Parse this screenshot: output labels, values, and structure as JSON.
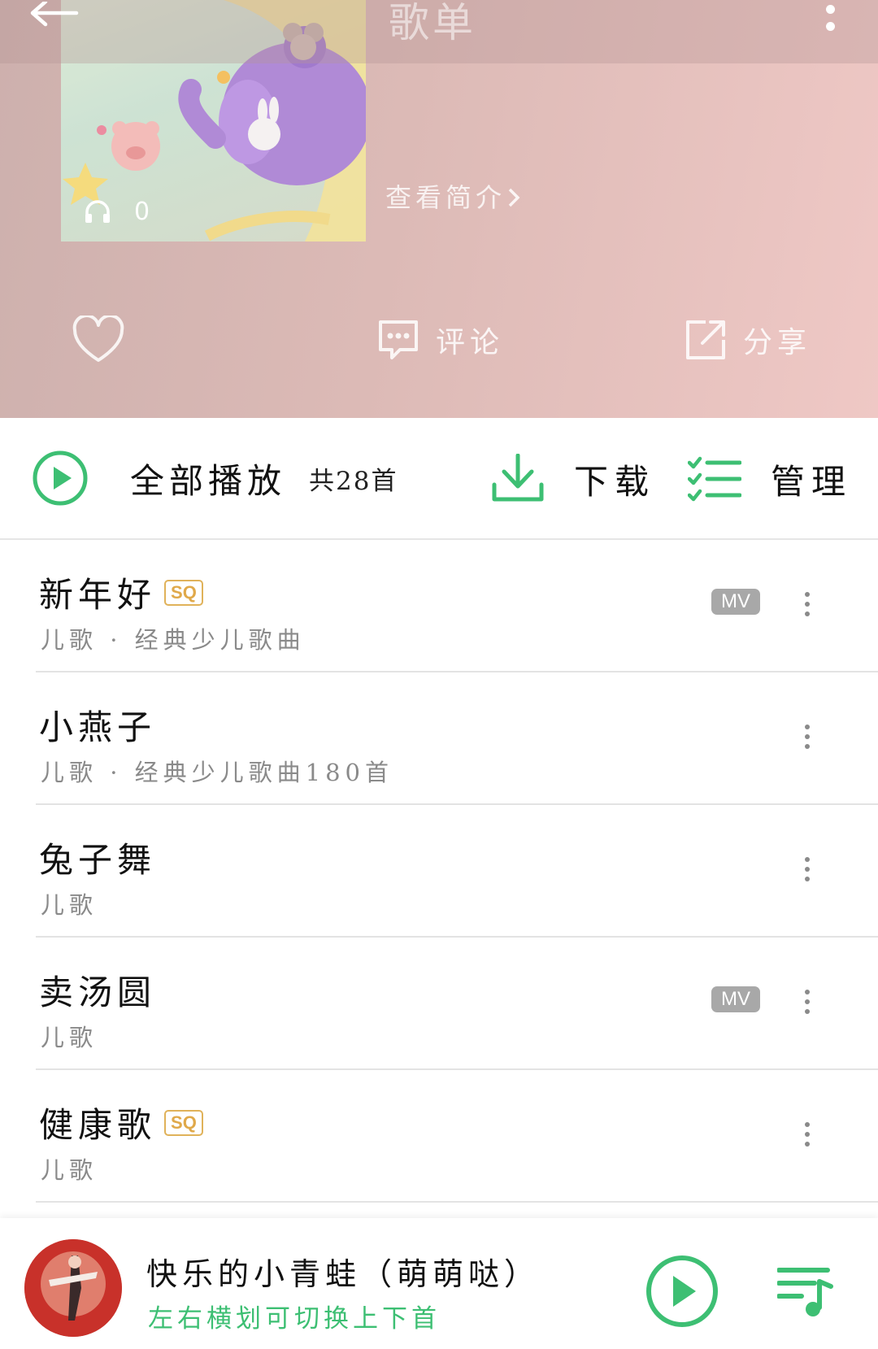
{
  "header": {
    "title": "歌单",
    "play_count": "0",
    "intro_link": "查看简介",
    "comment_label": "评论",
    "share_label": "分享"
  },
  "play_bar": {
    "play_all_label": "全部播放",
    "count_label": "共28首",
    "download_label": "下载",
    "manage_label": "管理"
  },
  "songs": [
    {
      "title": "新年好",
      "subtitle": "儿歌 · 经典少儿歌曲",
      "sq": "SQ",
      "mv": "MV"
    },
    {
      "title": "小燕子",
      "subtitle": "儿歌 · 经典少儿歌曲180首"
    },
    {
      "title": "兔子舞",
      "subtitle": "儿歌"
    },
    {
      "title": "卖汤圆",
      "subtitle": "儿歌",
      "mv": "MV"
    },
    {
      "title": "健康歌",
      "subtitle": "儿歌",
      "sq": "SQ"
    }
  ],
  "player": {
    "title": "快乐的小青蛙（萌萌哒）",
    "hint": "左右横划可切换上下首"
  },
  "colors": {
    "accent": "#3dbf73",
    "sq_badge": "#e0a94a",
    "mv_badge": "#a8a8a8"
  },
  "icons": [
    "back-arrow-icon",
    "more-vertical-icon",
    "headphones-icon",
    "heart-icon",
    "comment-icon",
    "share-icon",
    "play-circle-icon",
    "download-icon",
    "manage-list-icon",
    "playlist-queue-icon"
  ]
}
